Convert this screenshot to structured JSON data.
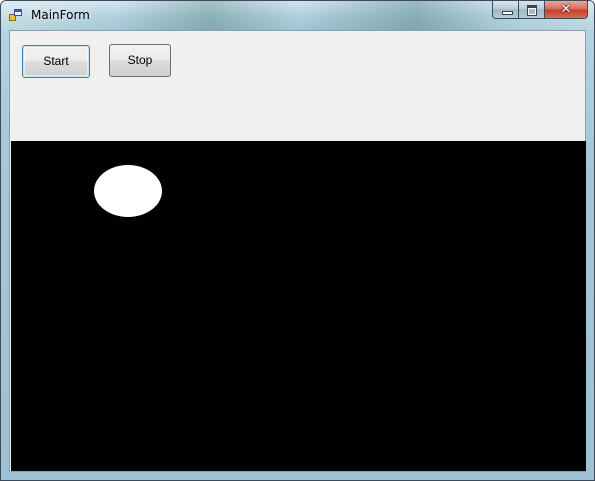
{
  "window": {
    "title": "MainForm",
    "caption_buttons": {
      "minimize_icon": "minimize-icon",
      "maximize_icon": "maximize-icon",
      "close_icon": "close-icon",
      "close_glyph": "✕"
    }
  },
  "toolbar": {
    "start_label": "Start",
    "stop_label": "Stop"
  },
  "canvas": {
    "background_color": "#000000",
    "ball_color": "#ffffff",
    "shape": "ellipse"
  }
}
